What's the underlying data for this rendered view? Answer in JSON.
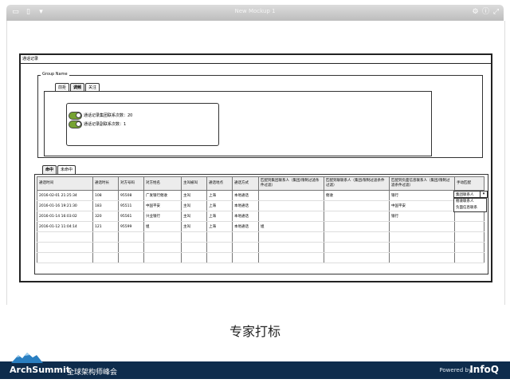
{
  "window": {
    "title": "New Mockup 1"
  },
  "mockup": {
    "panel_title": "通话记录",
    "group_label": "Group Name",
    "group_tabs": [
      "前拒",
      "调频",
      "关注"
    ],
    "toggles": [
      "通话记录集团联系次数：20",
      "通话记录副联系次数：1"
    ],
    "data_tabs": [
      "命中",
      "未命中"
    ],
    "columns": [
      "通话时间",
      "通话时长",
      "对方号码",
      "对方姓名",
      "主叫被叫",
      "通话地点",
      "通话方式",
      "匹配到集团联系人（集团/限制过滤条件过滤）",
      "匹配到联联系人（集团/限制过滤条件过滤）",
      "匹配到负面信息联系人（集团/限制过滤条件过滤）",
      "手动匹配"
    ],
    "rows": [
      [
        "2016-02-01 21:25:34",
        "108",
        "95508",
        "广发银行催收",
        "主叫",
        "上海",
        "本地通话",
        "",
        "催收",
        "银行",
        ""
      ],
      [
        "2016-01-16 19:21:30",
        "183",
        "95511",
        "中国平安",
        "主叫",
        "上海",
        "本地通话",
        "",
        "",
        "中国平安",
        ""
      ],
      [
        "2016-01-14 16:03:02",
        "320",
        "95561",
        "兴业银行",
        "主叫",
        "上海",
        "本地通话",
        "",
        "",
        "银行",
        ""
      ],
      [
        "2016-01-12 11:04:14",
        "121",
        "95599",
        "姐",
        "主叫",
        "上海",
        "本地通话",
        "姐",
        "",
        "",
        ""
      ],
      [
        "",
        "",
        "",
        "",
        "",
        "",
        "",
        "",
        "",
        "",
        ""
      ],
      [
        "",
        "",
        "",
        "",
        "",
        "",
        "",
        "",
        "",
        "",
        ""
      ],
      [
        "",
        "",
        "",
        "",
        "",
        "",
        "",
        "",
        "",
        "",
        ""
      ]
    ],
    "manual_select": {
      "value": "集团联系人",
      "options": [
        "催收联系人",
        "负面信息联系"
      ]
    }
  },
  "caption": "专家打标",
  "footer": {
    "brand": "ArchSummit",
    "subtitle": "全球架构师峰会",
    "powered": "Powered by",
    "logo": "InfoQ"
  },
  "colors": {
    "toggle_green": "#76a332",
    "footer_bg": "#0e2c4c"
  }
}
